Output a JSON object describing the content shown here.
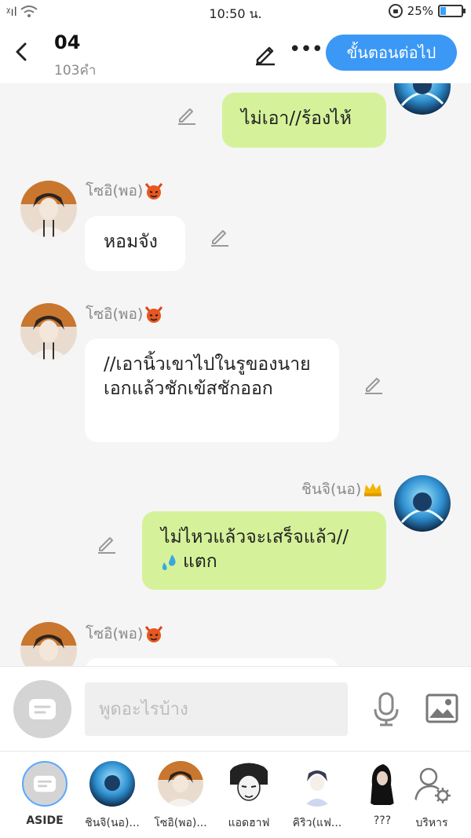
{
  "status_bar": {
    "time": "10:50 น.",
    "battery": "25%",
    "battery_level": 0.25
  },
  "header": {
    "chapter_title": "04",
    "word_count": "103คำ",
    "next_button": "ขั้นตอนต่อไป"
  },
  "messages": [
    {
      "side": "right",
      "text": "ไม่เอา//ร้องไห้"
    },
    {
      "side": "left",
      "sender": "โซอิ(พอ)",
      "text": "หอมจัง"
    },
    {
      "side": "left",
      "sender": "โซอิ(พอ)",
      "text": "//เอานิ้วเขาไปในรูของนายเอกแล้วชักเข้สชักออก"
    },
    {
      "side": "right",
      "sender": "ชินจิ(นอ)",
      "text": "ไม่ไหวแล้วจะเสร็จแล้ว//",
      "text2": "แตก"
    },
    {
      "side": "left",
      "sender": "โซอิ(พอ)",
      "text": ""
    }
  ],
  "input": {
    "placeholder": "พูดอะไรบ้าง"
  },
  "characters": [
    {
      "label": "ASIDE"
    },
    {
      "label": "ชินจิ(นอ)..."
    },
    {
      "label": "โซอิ(พอ)..."
    },
    {
      "label": "แอดฮาฟ"
    },
    {
      "label": "คิริว(แฟ..."
    },
    {
      "label": "???"
    },
    {
      "label": "บริหาร"
    }
  ],
  "colors": {
    "accent": "#3b98f5",
    "bubble_out": "#d5f29a",
    "bubble_in": "#ffffff",
    "background": "#f5f5f5"
  }
}
